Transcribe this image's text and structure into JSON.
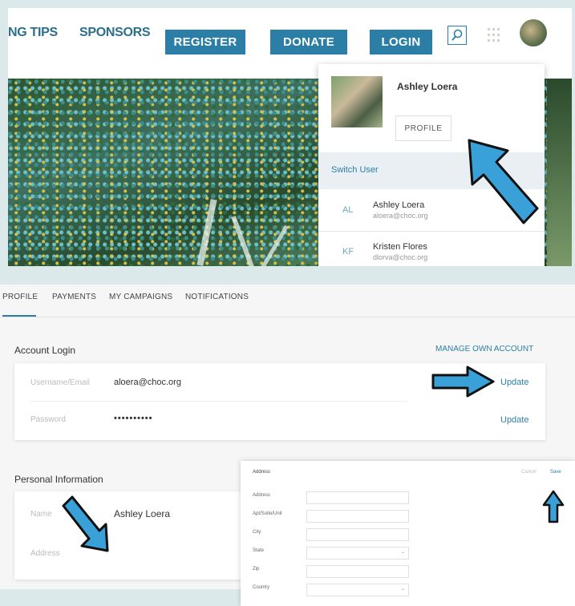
{
  "header": {
    "nav": [
      "NG TIPS",
      "SPONSORS"
    ],
    "buttons": [
      "REGISTER",
      "DONATE",
      "LOGIN"
    ],
    "search_icon": "search-icon",
    "grid_icon": "grid-icon"
  },
  "dropdown": {
    "user_name": "Ashley Loera",
    "profile_label": "PROFILE",
    "switch_label": "Switch User",
    "users": [
      {
        "initials": "AL",
        "name": "Ashley Loera",
        "email": "aloera@choc.org"
      },
      {
        "initials": "KF",
        "name": "Kristen Flores",
        "email": "dlorva@choc.org"
      }
    ]
  },
  "account": {
    "tabs": [
      "PROFILE",
      "PAYMENTS",
      "MY CAMPAIGNS",
      "NOTIFICATIONS"
    ],
    "active_tab": "PROFILE",
    "login_title": "Account Login",
    "manage_link": "MANAGE OWN ACCOUNT",
    "username_label": "Username/Email",
    "username_value": "aloera@choc.org",
    "password_label": "Password",
    "password_value": "••••••••••",
    "update_label": "Update",
    "personal_title": "Personal Information",
    "name_label": "Name",
    "name_value": "Ashley Loera",
    "address_label": "Address"
  },
  "address_form": {
    "title": "Address",
    "cancel_label": "Cancel",
    "save_label": "Save",
    "fields": [
      "Address",
      "Apt/Suite/Unit",
      "City",
      "State",
      "Zip",
      "Country"
    ]
  },
  "colors": {
    "accent": "#2b7fa6",
    "arrow": "#3aa0d8",
    "background": "#dce9ea"
  }
}
